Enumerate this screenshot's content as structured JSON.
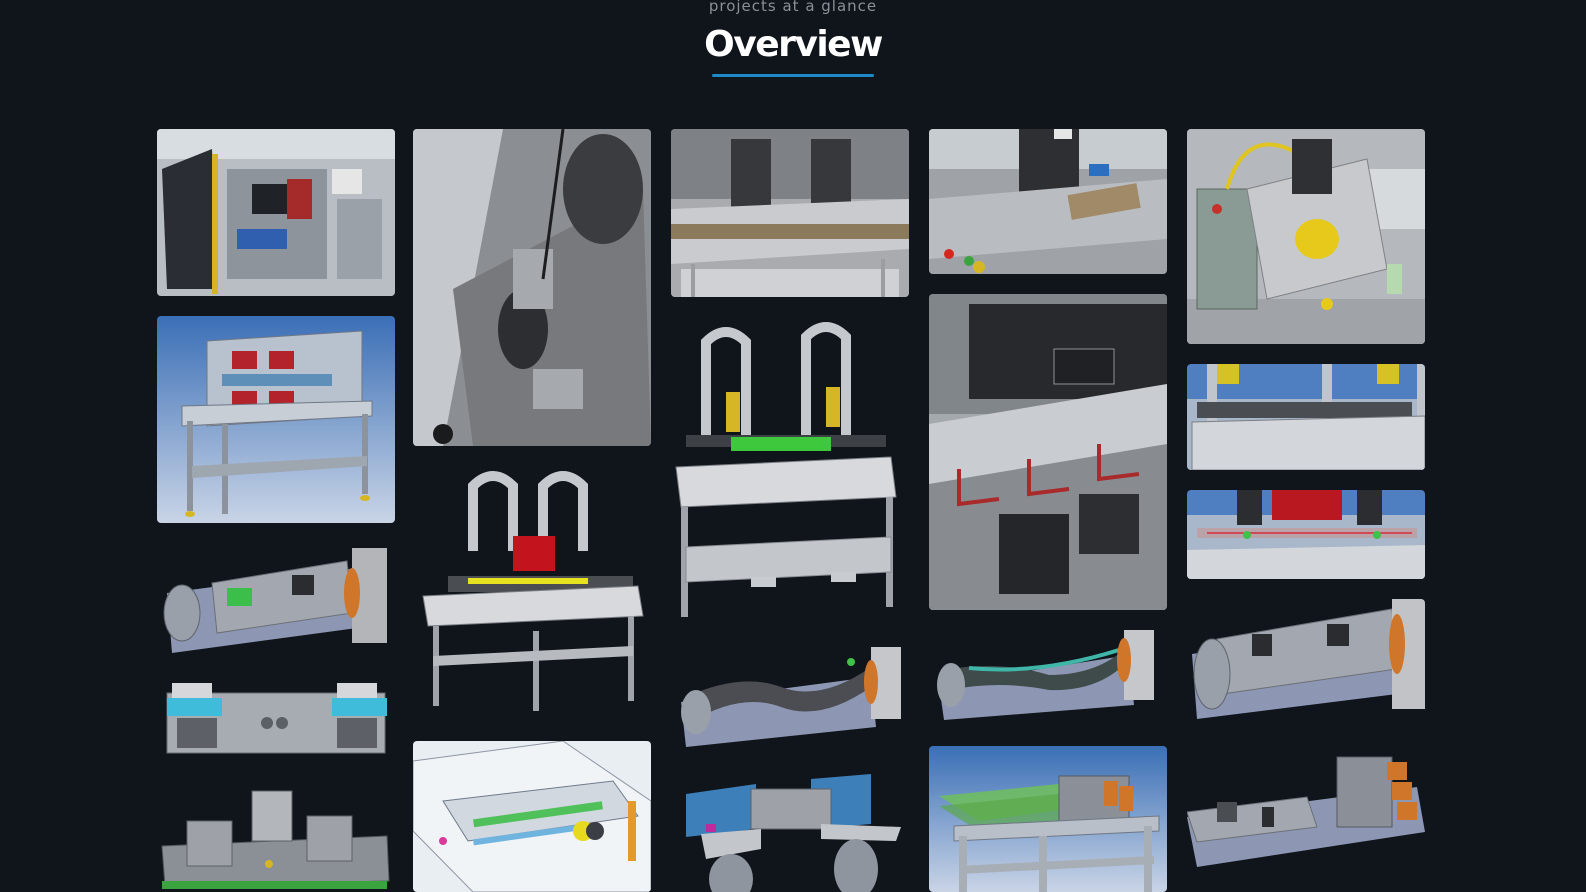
{
  "header": {
    "eyebrow": "projects at a glance",
    "title": "Overview"
  },
  "colors": {
    "background": "#10141b",
    "accent": "#1e88c8",
    "title": "#ffffff",
    "eyebrow": "#8b8f96"
  },
  "gallery": {
    "images": [
      {
        "id": "photo-assembly-cell",
        "kind": "photo"
      },
      {
        "id": "photo-fixture-closeup",
        "kind": "photo"
      },
      {
        "id": "photo-twin-press",
        "kind": "photo"
      },
      {
        "id": "photo-workstation-overhead",
        "kind": "photo"
      },
      {
        "id": "photo-yellow-cable-machine",
        "kind": "photo"
      },
      {
        "id": "render-frame-red-clamps",
        "kind": "render"
      },
      {
        "id": "render-twin-tower-red",
        "kind": "render"
      },
      {
        "id": "render-twin-tower-green",
        "kind": "render"
      },
      {
        "id": "photo-enclosure-rail",
        "kind": "photo"
      },
      {
        "id": "render-fixture-top-yellow",
        "kind": "render"
      },
      {
        "id": "render-fixture-top-red",
        "kind": "render"
      },
      {
        "id": "render-rotary-fixture-green",
        "kind": "render"
      },
      {
        "id": "render-fixture-plate-cyan",
        "kind": "render"
      },
      {
        "id": "render-fixture-base-green-edge",
        "kind": "render"
      },
      {
        "id": "render-rotary-fixture-arc",
        "kind": "render"
      },
      {
        "id": "render-rotary-fixture-teal",
        "kind": "render"
      },
      {
        "id": "render-rotary-fixture-plain",
        "kind": "render"
      },
      {
        "id": "render-conveyor-topview",
        "kind": "render"
      },
      {
        "id": "render-fixture-blue-panels",
        "kind": "render"
      },
      {
        "id": "render-frame-green-rails",
        "kind": "render"
      },
      {
        "id": "render-fixture-orange-clamps",
        "kind": "render"
      }
    ]
  }
}
